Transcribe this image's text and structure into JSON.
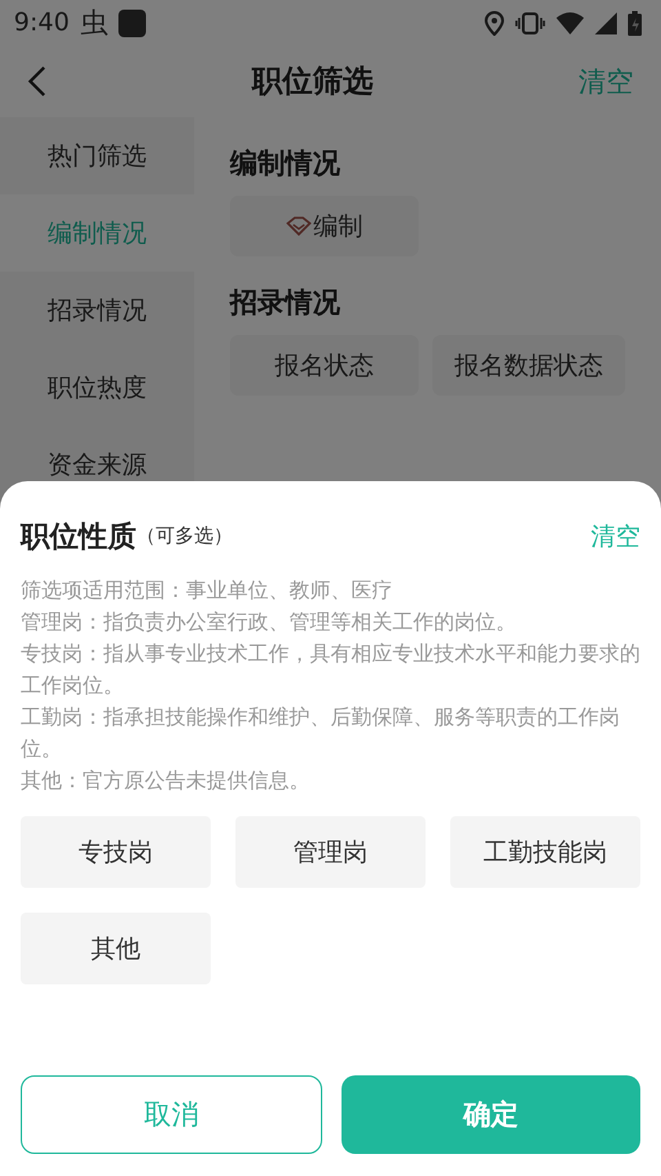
{
  "status_bar": {
    "time": "9:40",
    "app_glyph": "虫"
  },
  "header": {
    "title": "职位筛选",
    "clear": "清空"
  },
  "sidebar": {
    "items": [
      {
        "label": "热门筛选",
        "selected": false
      },
      {
        "label": "编制情况",
        "selected": true
      },
      {
        "label": "招录情况",
        "selected": false
      },
      {
        "label": "职位热度",
        "selected": false
      },
      {
        "label": "资金来源",
        "selected": false
      }
    ]
  },
  "sections": [
    {
      "title": "编制情况",
      "options": [
        {
          "label": "编制",
          "kind": "gem",
          "selected": false
        }
      ]
    },
    {
      "title": "招录情况",
      "options": [
        {
          "label": "报名状态",
          "kind": "plain",
          "selected": false
        },
        {
          "label": "报名数据状态",
          "kind": "plain",
          "selected": false
        }
      ]
    }
  ],
  "sheet": {
    "title": "职位性质",
    "hint": "（可多选）",
    "clear": "清空",
    "notes": [
      "筛选项适用范围：事业单位、教师、医疗",
      "管理岗：指负责办公室行政、管理等相关工作的岗位。",
      "专技岗：指从事专业技术工作，具有相应专业技术水平和能力要求的工作岗位。",
      "工勤岗：指承担技能操作和维护、后勤保障、服务等职责的工作岗位。",
      "其他：官方原公告未提供信息。"
    ],
    "options": [
      {
        "label": "专技岗",
        "selected": false
      },
      {
        "label": "管理岗",
        "selected": false
      },
      {
        "label": "工勤技能岗",
        "selected": false
      },
      {
        "label": "其他",
        "selected": false
      }
    ],
    "cancel": "取消",
    "confirm": "确定"
  }
}
